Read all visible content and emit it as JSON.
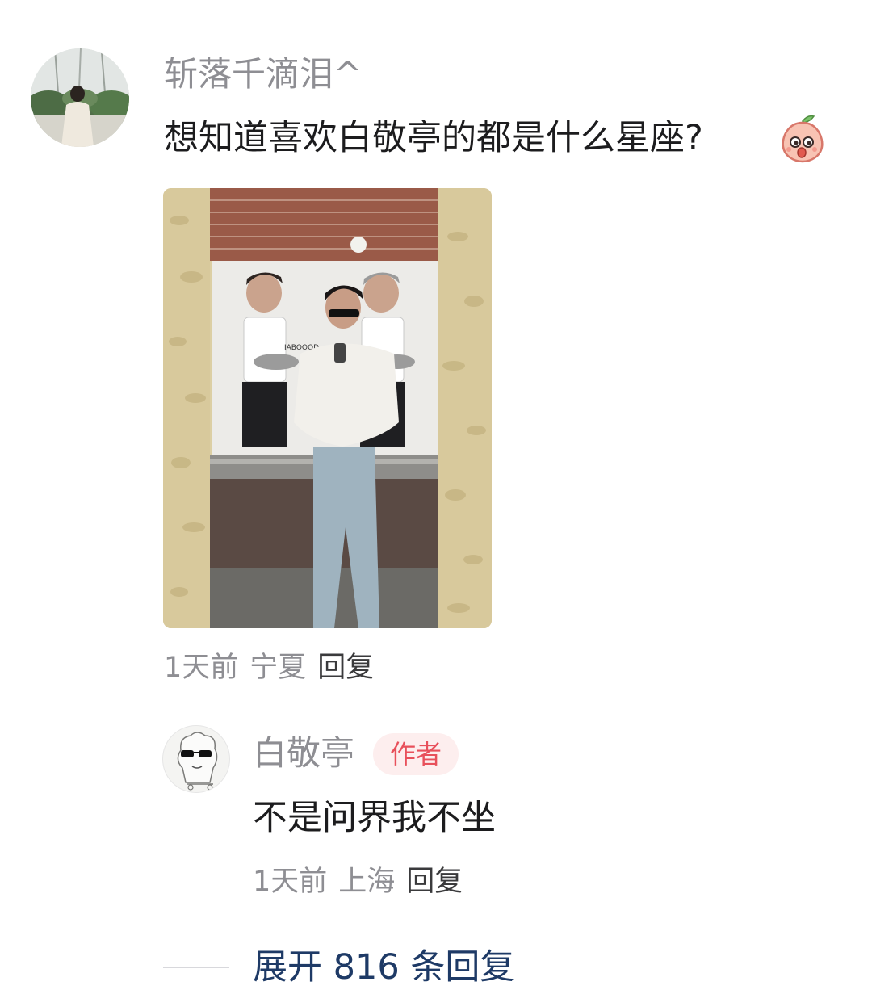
{
  "main_comment": {
    "username": "斩落千滴泪^",
    "text": "想知道喜欢白敬亭的都是什么星座?",
    "emoji_icon": "peach-emoji-icon",
    "time": "1天前",
    "location": "宁夏",
    "reply_label": "回复",
    "photo_poster_text": "IABOOOD"
  },
  "reply": {
    "username": "白敬亭",
    "badge": "作者",
    "text": "不是问界我不坐",
    "time": "1天前",
    "location": "上海",
    "reply_label": "回复"
  },
  "expand": {
    "label": "展开 816 条回复"
  },
  "colors": {
    "username": "#8e8e93",
    "text": "#1c1c1e",
    "badge_bg": "#fdeeee",
    "badge_text": "#e8505b",
    "expand": "#1e3a66"
  }
}
